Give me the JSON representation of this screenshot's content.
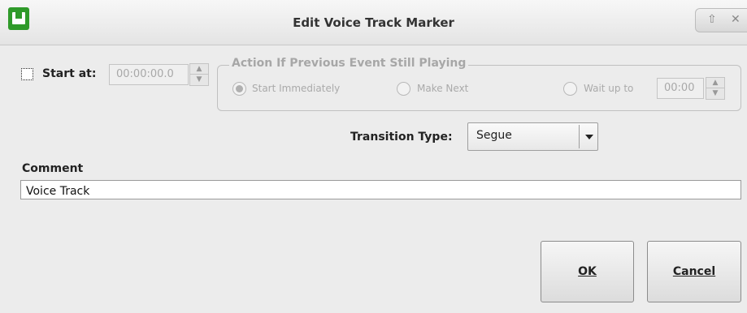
{
  "window": {
    "title": "Edit Voice Track Marker",
    "logo_icon": "app-logo-icon",
    "shade_icon": "⇧",
    "close_icon": "✕"
  },
  "start": {
    "checked": false,
    "label": "Start at:",
    "time_value": "00:00:00.0"
  },
  "action_group": {
    "title": "Action If Previous Event Still Playing",
    "options": [
      {
        "label": "Start Immediately",
        "selected": true
      },
      {
        "label": "Make Next",
        "selected": false
      },
      {
        "label": "Wait up to",
        "selected": false
      }
    ],
    "wait_value": "00:00"
  },
  "transition": {
    "label": "Transition Type:",
    "selected": "Segue"
  },
  "comment": {
    "label": "Comment",
    "value": "Voice Track"
  },
  "buttons": {
    "ok": "OK",
    "cancel": "Cancel"
  },
  "colors": {
    "logo_green": "#2f9a2a",
    "background": "#ececec",
    "disabled_text": "#a8a8a8"
  }
}
